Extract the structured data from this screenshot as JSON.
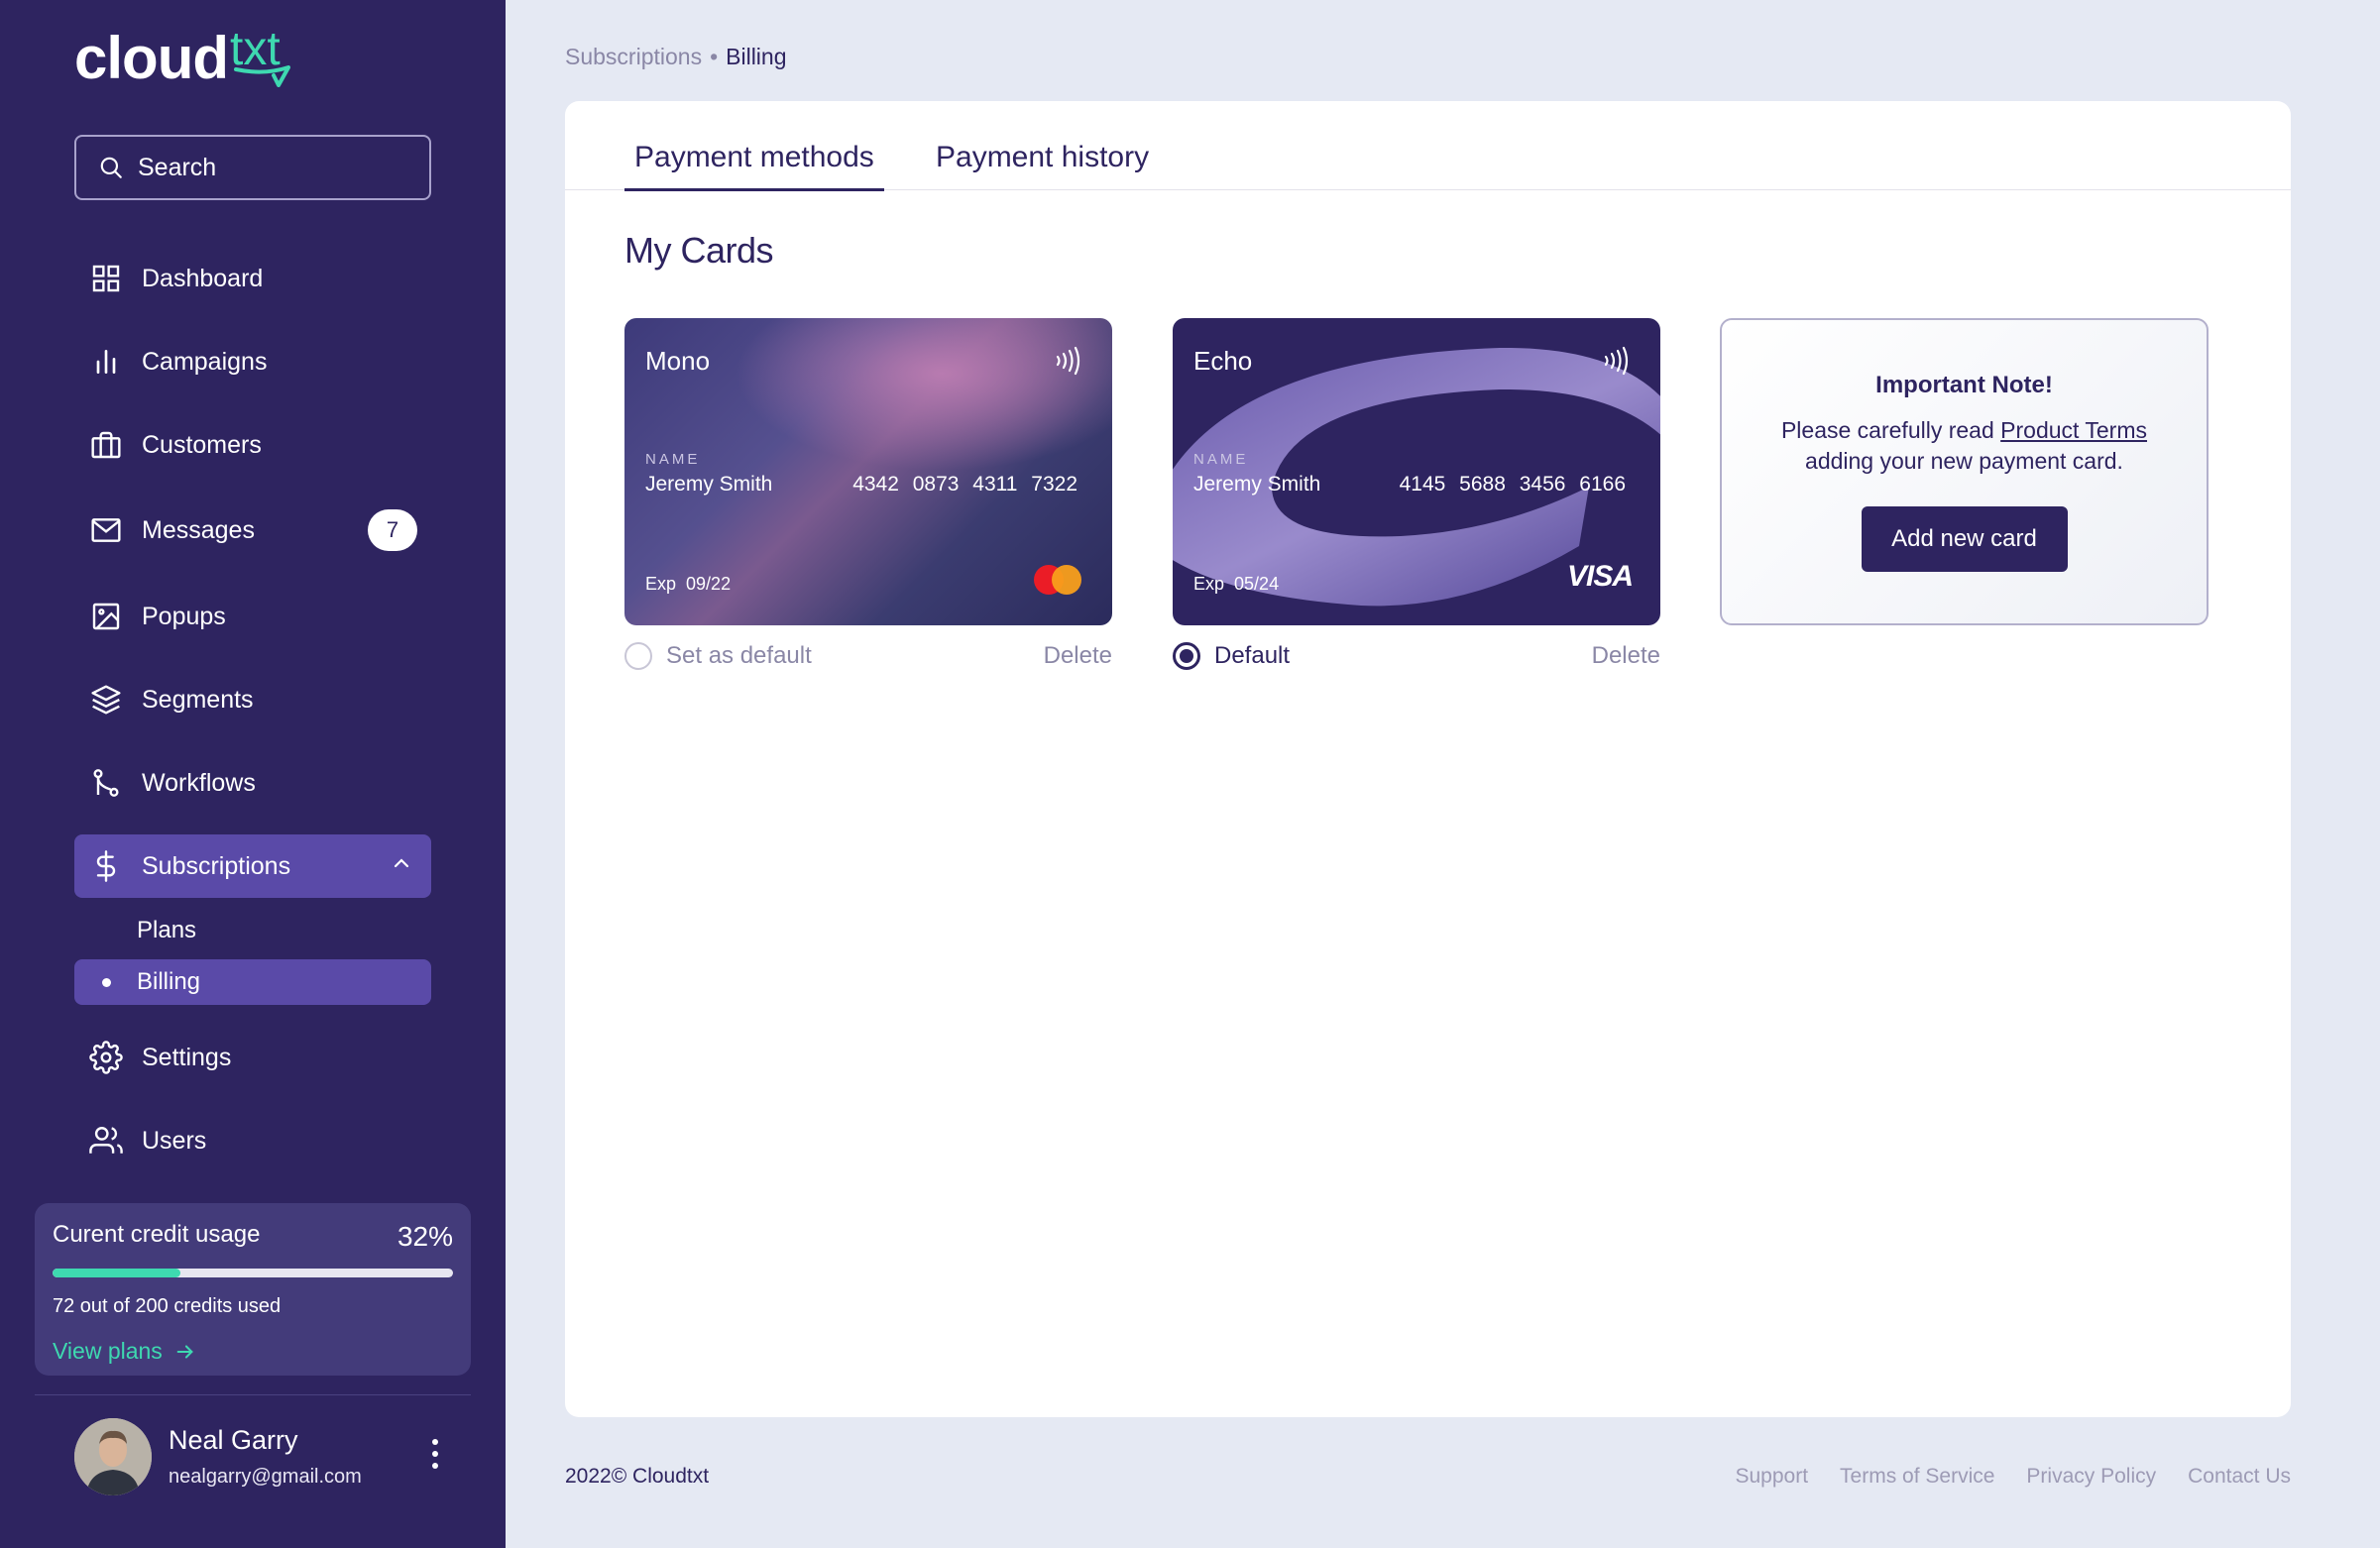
{
  "app": {
    "logo_main": "cloud",
    "logo_accent": "txt",
    "accent_color": "#3ed9b0",
    "sidebar_color": "#2e2460"
  },
  "sidebar": {
    "search_placeholder": "Search",
    "items": [
      {
        "label": "Dashboard",
        "icon": "grid-icon"
      },
      {
        "label": "Campaigns",
        "icon": "bar-chart-icon"
      },
      {
        "label": "Customers",
        "icon": "briefcase-icon"
      },
      {
        "label": "Messages",
        "icon": "mail-icon",
        "badge": "7"
      },
      {
        "label": "Popups",
        "icon": "image-icon"
      },
      {
        "label": "Segments",
        "icon": "layers-icon"
      },
      {
        "label": "Workflows",
        "icon": "git-branch-icon"
      },
      {
        "label": "Subscriptions",
        "icon": "dollar-icon",
        "expanded": true
      },
      {
        "label": "Settings",
        "icon": "gear-icon"
      },
      {
        "label": "Users",
        "icon": "users-icon"
      }
    ],
    "sub_items": [
      {
        "label": "Plans"
      },
      {
        "label": "Billing",
        "active": true
      }
    ],
    "credit": {
      "title": "Curent credit usage",
      "percent_label": "32%",
      "fraction": 0.32,
      "used_prefix": "72",
      "used_mid": " out of ",
      "used_total": "200",
      "used_suffix": " credits used",
      "link": "View plans"
    },
    "user": {
      "name": "Neal Garry",
      "email": "nealgarry@gmail.com"
    }
  },
  "breadcrumb": {
    "parent": "Subscriptions",
    "separator": "•",
    "current": "Billing"
  },
  "tabs": [
    {
      "label": "Payment methods",
      "active": true
    },
    {
      "label": "Payment history",
      "active": false
    }
  ],
  "section_title": "My Cards",
  "cards": [
    {
      "name": "Mono",
      "name_label": "NAME",
      "holder": "Jeremy Smith",
      "number": "4342 0873 4311 7322",
      "exp_label": "Exp",
      "exp": "09/22",
      "brand": "mastercard",
      "action_label": "Set as default",
      "is_default": false,
      "delete_label": "Delete"
    },
    {
      "name": "Echo",
      "name_label": "NAME",
      "holder": "Jeremy Smith",
      "number": "4145 5688 3456 6166",
      "exp_label": "Exp",
      "exp": "05/24",
      "brand": "VISA",
      "action_label": "Default",
      "is_default": true,
      "delete_label": "Delete"
    }
  ],
  "note": {
    "title": "Important Note!",
    "text_before": "Please carefully read ",
    "link": "Product Terms",
    "text_after": " adding your new payment card.",
    "button": "Add new card"
  },
  "footer": {
    "copyright": "2022© Cloudtxt",
    "links": [
      "Support",
      "Terms of Service",
      "Privacy Policy",
      "Contact Us"
    ]
  }
}
